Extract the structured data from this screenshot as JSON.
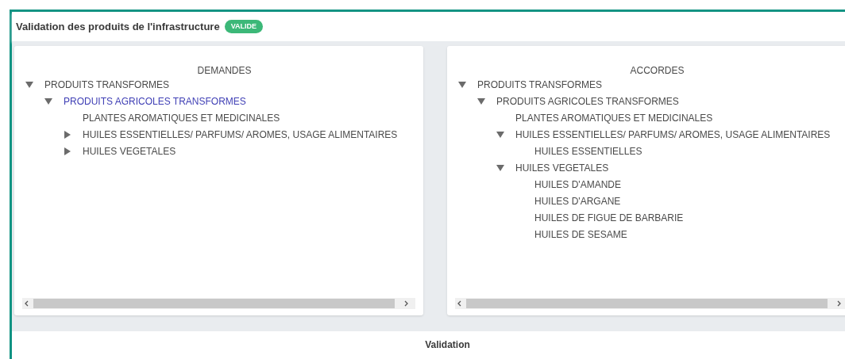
{
  "header": {
    "title": "Validation des produits de l'infrastructure",
    "badge": "VALIDE"
  },
  "panels": [
    {
      "title": "DEMANDES",
      "tree": [
        {
          "label": "PRODUITS TRANSFORMES",
          "kind": "branch",
          "expanded": true,
          "selected": false,
          "children": [
            {
              "label": "PRODUITS AGRICOLES TRANSFORMES",
              "kind": "branch",
              "expanded": true,
              "selected": true,
              "children": [
                {
                  "label": "PLANTES AROMATIQUES ET MEDICINALES",
                  "kind": "leaf",
                  "selected": false
                },
                {
                  "label": "HUILES ESSENTIELLES/ PARFUMS/ AROMES, USAGE ALIMENTAIRES",
                  "kind": "branch",
                  "expanded": false,
                  "selected": false
                },
                {
                  "label": "HUILES VEGETALES",
                  "kind": "branch",
                  "expanded": false,
                  "selected": false
                }
              ]
            }
          ]
        }
      ]
    },
    {
      "title": "ACCORDES",
      "tree": [
        {
          "label": "PRODUITS TRANSFORMES",
          "kind": "branch",
          "expanded": true,
          "selected": false,
          "children": [
            {
              "label": "PRODUITS AGRICOLES TRANSFORMES",
              "kind": "branch",
              "expanded": true,
              "selected": false,
              "children": [
                {
                  "label": "PLANTES AROMATIQUES ET MEDICINALES",
                  "kind": "leaf",
                  "selected": false
                },
                {
                  "label": "HUILES ESSENTIELLES/ PARFUMS/ AROMES, USAGE ALIMENTAIRES",
                  "kind": "branch",
                  "expanded": true,
                  "selected": false,
                  "children": [
                    {
                      "label": "HUILES ESSENTIELLES",
                      "kind": "leaf",
                      "selected": false
                    }
                  ]
                },
                {
                  "label": "HUILES VEGETALES",
                  "kind": "branch",
                  "expanded": true,
                  "selected": false,
                  "children": [
                    {
                      "label": "HUILES D'AMANDE",
                      "kind": "leaf",
                      "selected": false
                    },
                    {
                      "label": "HUILES D'ARGANE",
                      "kind": "leaf",
                      "selected": false
                    },
                    {
                      "label": "HUILES DE FIGUE DE BARBARIE",
                      "kind": "leaf",
                      "selected": false
                    },
                    {
                      "label": "HUILES DE SESAME",
                      "kind": "leaf",
                      "selected": false
                    }
                  ]
                }
              ]
            }
          ]
        }
      ]
    }
  ],
  "footer": {
    "title": "Validation"
  }
}
